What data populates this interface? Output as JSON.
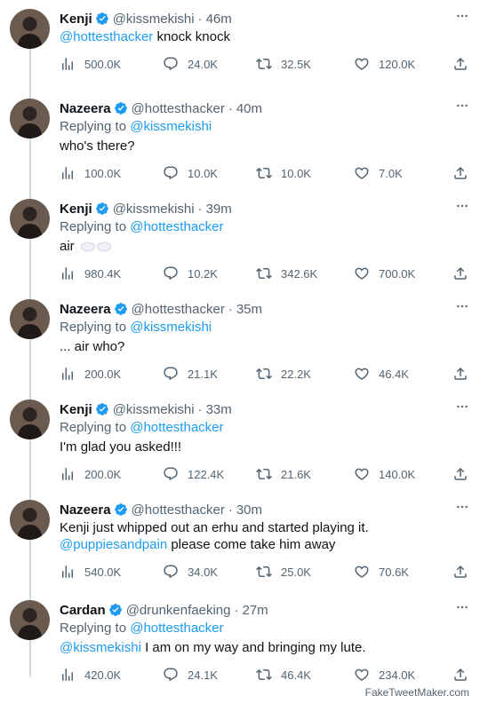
{
  "accent_color": "#1d9bf0",
  "text_muted_color": "#536471",
  "tweets": [
    {
      "name": "Kenji",
      "handle": "@kissmekishi",
      "time": "46m",
      "replying_to": "",
      "body": [
        {
          "text": "@hottesthacker",
          "link": true
        },
        {
          "text": " knock knock",
          "link": false
        }
      ],
      "views": "500.0K",
      "replies": "24.0K",
      "retweets": "32.5K",
      "likes": "120.0K"
    },
    {
      "name": "Nazeera",
      "handle": "@hottesthacker",
      "time": "40m",
      "replying_to": "@kissmekishi",
      "body": [
        {
          "text": "who's there?",
          "link": false
        }
      ],
      "views": "100.0K",
      "replies": "10.0K",
      "retweets": "10.0K",
      "likes": "7.0K"
    },
    {
      "name": "Kenji",
      "handle": "@kissmekishi",
      "time": "39m",
      "replying_to": "@hottesthacker",
      "body": [
        {
          "text": "air",
          "link": false
        }
      ],
      "body_icon": "cloud-emoji",
      "views": "980.4K",
      "replies": "10.2K",
      "retweets": "342.6K",
      "likes": "700.0K"
    },
    {
      "name": "Nazeera",
      "handle": "@hottesthacker",
      "time": "35m",
      "replying_to": "@kissmekishi",
      "body": [
        {
          "text": "... air who?",
          "link": false
        }
      ],
      "views": "200.0K",
      "replies": "21.1K",
      "retweets": "22.2K",
      "likes": "46.4K"
    },
    {
      "name": "Kenji",
      "handle": "@kissmekishi",
      "time": "33m",
      "replying_to": "@hottesthacker",
      "body": [
        {
          "text": "I'm glad you asked!!!",
          "link": false
        }
      ],
      "views": "200.0K",
      "replies": "122.4K",
      "retweets": "21.6K",
      "likes": "140.0K"
    },
    {
      "name": "Nazeera",
      "handle": "@hottesthacker",
      "time": "30m",
      "replying_to": "",
      "body": [
        {
          "text": "Kenji just whipped out an erhu and started playing it.",
          "link": false,
          "newline_after": true
        },
        {
          "text": "@puppiesandpain",
          "link": true
        },
        {
          "text": " please come take him away",
          "link": false
        }
      ],
      "views": "540.0K",
      "replies": "34.0K",
      "retweets": "25.0K",
      "likes": "70.6K"
    },
    {
      "name": "Cardan",
      "handle": "@drunkenfaeking",
      "time": "27m",
      "replying_to": "@hottesthacker",
      "body": [
        {
          "text": "@kissmekishi",
          "link": true
        },
        {
          "text": " I am on my way and bringing my lute.",
          "link": false
        }
      ],
      "views": "420.0K",
      "replies": "24.1K",
      "retweets": "46.4K",
      "likes": "234.0K"
    }
  ],
  "labels": {
    "replying_prefix": "Replying to "
  },
  "footer": "FakeTweetMaker.com"
}
